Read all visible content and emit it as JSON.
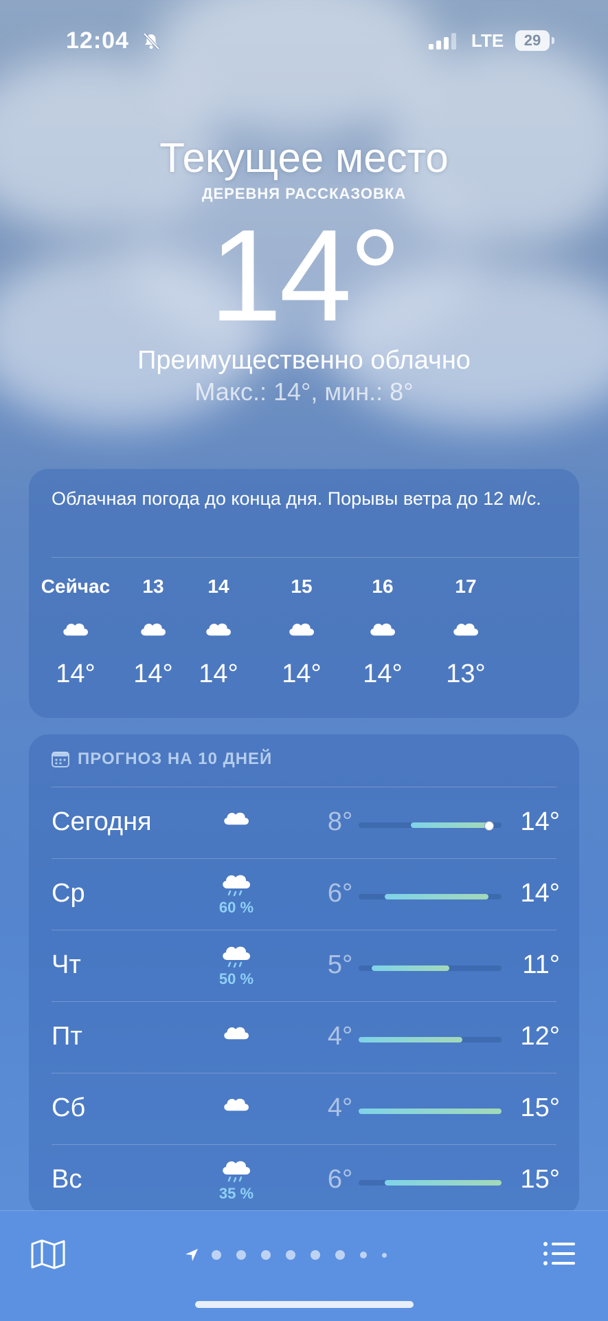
{
  "status_bar": {
    "time": "12:04",
    "network": "LTE",
    "battery": "29",
    "icons": [
      "bell-muted-icon",
      "signal-icon",
      "battery-icon"
    ]
  },
  "header": {
    "title": "Текущее место",
    "locality": "ДЕРЕВНЯ РАССКАЗОВКА",
    "temperature": "14°",
    "condition": "Преимущественно облачно",
    "hi_lo": "Макс.: 14°, мин.: 8°"
  },
  "hourly": {
    "summary": "Облачная погода до конца дня. Порывы ветра до 12 м/с.",
    "hours": [
      {
        "label": "Сейчас",
        "icon": "cloud-icon",
        "temp": "14°"
      },
      {
        "label": "13",
        "icon": "cloud-icon",
        "temp": "14°"
      },
      {
        "label": "14",
        "icon": "cloud-icon",
        "temp": "14°"
      },
      {
        "label": "15",
        "icon": "cloud-icon",
        "temp": "14°"
      },
      {
        "label": "16",
        "icon": "cloud-icon",
        "temp": "14°"
      },
      {
        "label": "17",
        "icon": "cloud-icon",
        "temp": "13°"
      }
    ]
  },
  "daily": {
    "title": "ПРОГНОЗ НА 10 ДНЕЙ",
    "title_icon": "calendar-icon",
    "days": [
      {
        "name": "Сегодня",
        "icon": "cloud-icon",
        "precip": "",
        "min": "8°",
        "max": "14°",
        "min_val": 8,
        "max_val": 14,
        "current": 14
      },
      {
        "name": "Ср",
        "icon": "cloud-rain-icon",
        "precip": "60 %",
        "min": "6°",
        "max": "14°",
        "min_val": 6,
        "max_val": 14
      },
      {
        "name": "Чт",
        "icon": "cloud-rain-icon",
        "precip": "50 %",
        "min": "5°",
        "max": "11°",
        "min_val": 5,
        "max_val": 11
      },
      {
        "name": "Пт",
        "icon": "cloud-icon",
        "precip": "",
        "min": "4°",
        "max": "12°",
        "min_val": 4,
        "max_val": 12
      },
      {
        "name": "Сб",
        "icon": "cloud-icon",
        "precip": "",
        "min": "4°",
        "max": "15°",
        "min_val": 4,
        "max_val": 15
      },
      {
        "name": "Вс",
        "icon": "cloud-rain-icon",
        "precip": "35 %",
        "min": "6°",
        "max": "15°",
        "min_val": 6,
        "max_val": 15
      }
    ],
    "range_min": 4,
    "range_max": 15
  },
  "bottom_bar": {
    "map_icon": "map-icon",
    "location_icon": "location-arrow-icon",
    "page_dots": 9,
    "list_icon": "list-icon"
  }
}
